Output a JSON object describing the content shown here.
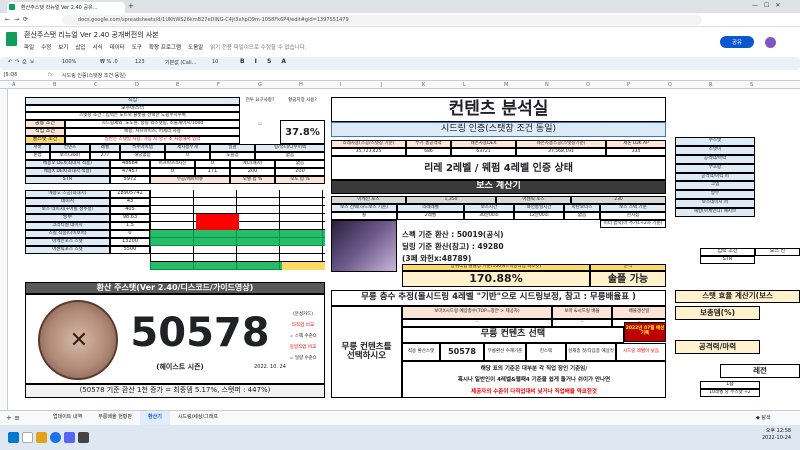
{
  "browser": {
    "tab_title": "환산주스탯 리뉴얼 Ver 2.40 공유...",
    "url": "docs.google.com/spreadsheets/d/1UKhWS26kmB27eDING-C4jt3xhpO9m-1058Fk6P4/edit#gid=1397551479"
  },
  "doc": {
    "title": "환산주스탯 리뉴얼 Ver 2.40 공개버전의 사본",
    "menus": [
      "파일",
      "수정",
      "보기",
      "삽입",
      "서식",
      "데이터",
      "도구",
      "확장 프로그램",
      "도움말"
    ],
    "notice": "읽기 전용 파일이므로 수정할 수 없습니다.",
    "share": "공유"
  },
  "toolbar": {
    "zoom": "100%",
    "font": "기본값 (Cali...",
    "size": "10",
    "format": "123"
  },
  "fbar": {
    "cell": "J5:Q6",
    "fx": "fx",
    "content": "시드링 인증(스탯창 조건 동일)"
  },
  "columns": [
    "A",
    "B",
    "C",
    "D",
    "E",
    "F",
    "G",
    "H",
    "I",
    "J",
    "K",
    "L",
    "M",
    "N",
    "O",
    "P",
    "Q",
    "R",
    "S"
  ],
  "left": {
    "job_h": "직업",
    "job": "보우마스터",
    "req_h": "전투 요구사항?",
    "req": "황금치장 사용?",
    "desc": "스탯창 조건 : 입력은 노트북 슬롯을 선택한 도핑수치수록",
    "rows": [
      [
        "공통 조건",
        "시드링제외, 노도원, 몽링 외스탯링, 소울계이지/1000"
      ],
      [
        "직업 조건",
        "메용, 샤프아이즈, 어세리 사용"
      ],
      [
        "물스탯 조건",
        "일반은 스탯딜 사용, 가능 시 영구 소 사용해서 입력"
      ]
    ],
    "pct": "37.8%",
    "head1": [
      "서버",
      "컨텐츠",
      "레벨",
      "특수아이템",
      "제사용무게",
      "일괄",
      "링/유니/다수이팩"
    ],
    "r_a": [
      "본섭",
      "보스(300)",
      "277",
      "해당없음",
      "0",
      "노블업",
      "없음"
    ],
    "r_dex": [
      "메용오 DEX(최대치 적용)",
      "48684",
      "퍼프파츠4사진",
      "0",
      "메디(패치)",
      "없음"
    ],
    "r_dex2": [
      "메용X DEX(최대치 적용)",
      "47457",
      "0",
      "171",
      "200",
      "200"
    ],
    "str": "STR",
    "str_v": "5972",
    "mupdam": "무공/메파마쥬",
    "mobdo": "모텔 합 %",
    "modo": "모도 합 %",
    "bossq": "메용오 스공(최대치)",
    "bossq_v": "28905742",
    "dmg": "데미지",
    "dmg_v": "43",
    "bossdmg": "보스 데미지(+어빌 성추정)",
    "bossdmg_v": "405",
    "def": "방무",
    "def_v": "98.63",
    "crit": "크리티컬 데미지",
    "crit_v": "1.5",
    "skill": "스킬 적중(나이보어)",
    "skill_v": "0",
    "aura": "아케인포스 스탯",
    "aura_v": "13200",
    "aura2": "어센틱포스 스탯",
    "aura2_v": "5500",
    "hwan": "환산 주스탯(Ver 2.40/디스코드/가이드영상)",
    "big": "50578",
    "test": "(헤이스트 시즌)",
    "date": "2022. 10. 24",
    "note": [
      "(분성카드)",
      "타직업 비교",
      "= 스펙 수준O",
      "동일직업 비교",
      "= 딜량 수준O"
    ],
    "foot": "(50578 기준 환산 1천 증가 = 최종뎀 5.17%, 스탯퍼 : 447%)"
  },
  "center": {
    "title": "컨텐츠 분석실",
    "sub": "시드링 인증(스탯창 조건 동일)",
    "hdr": [
      "리레사용(스공/스탯창 기준)",
      "무기 총공격력",
      "웨폰사용DEX",
      "웨폰사용스공(스탯창기준)",
      "제논 LUK AP"
    ],
    "vals": [
      "35,723,425",
      "686",
      "63721",
      "37,568,191",
      "334"
    ],
    "state": "리레 2레벨 / 웨펌 4레벨 인증 상태",
    "boss_calc": "보스 계산기",
    "bhdr": [
      "아케인 포스",
      "1,350",
      "어센틱 포스",
      "230"
    ],
    "bhdr2": [
      "보스 선택(하드보스 기준)",
      "리레레벨",
      "보스시간",
      "와헌송딜시간",
      "마탄보너스",
      "보스 스택 기준"
    ],
    "bvals": [
      "윌",
      "2레벨",
      "30분00초",
      "12분00초",
      "없음",
      "현시점"
    ],
    "b3": "미터 밤럭(마 추가1+2차 기준)",
    "spec": "스펙 기준 환산 : 50019(공식)",
    "deal": "딜링 기준 환산(참고) : 49280",
    "deal2": "(3페 와헌x:48789)",
    "ratio_h": "상위작업 솔플정 기준(100%=특정작업 최소컷)",
    "ratio": "170.88%",
    "solo_h": "분석",
    "solo": "솔플 가능",
    "mul": "무릉 층수 추정(몰시드링 4레벨 \"기반\"으로 시드링보정, 참고 : 무릉배율표 )",
    "mul_h": [
      "보마X시드링 예상층수(TOP=창안 > 제공자)",
      "보마 &시드링 배율",
      "배율갱신일"
    ],
    "mul_v": [
      "-",
      "-",
      "-"
    ],
    "choose": "무릉 컨텐츠를 선택하시오",
    "mul_sel": "무릉 컨텐츠 선택",
    "mcol": [
      "적용 환산스탯",
      "50578",
      "무릉환산 수혜기준",
      "헌스택",
      "현재층 첫/다음층 예상컷",
      "시드링 레벨이 낮음"
    ],
    "mnote": "2022년 07월 예선 기록",
    "warn1": "해당 표의 기준은 대부분 각 직업 장인 기준임/",
    "warn2": "혹시나 일반인이 4레벨&웹패4 기준을 쉽게 돌거나 쉬이가 안나면",
    "warn3": "제공자의 수준이 다직업대비 낮거나 직업배율 약코한것"
  },
  "right": {
    "h": [
      "수스탯",
      "스텟이",
      "공격력/마력",
      "무호랑",
      "공격력/마력 퍼",
      "크뎀",
      "방무",
      "보스데미지 퍼",
      "해방(아케인디) 패시브"
    ],
    "sel": "입력 조건",
    "sel_a": "보스 선",
    "str": "STR",
    "eff": "스탯 효율 계산기(보스",
    "r1": "보총뎀(%)",
    "r2": "공격력/마력",
    "r3": "레전",
    "r4": "1층",
    "r5": "10레벨 당 주스탯 +2"
  },
  "tabs": [
    "업데이트 내역",
    "무릉배율 현황판",
    "환산기",
    "시드링/세상/그래프"
  ],
  "clock": {
    "time": "오후 12:58",
    "date": "2022-10-24"
  }
}
